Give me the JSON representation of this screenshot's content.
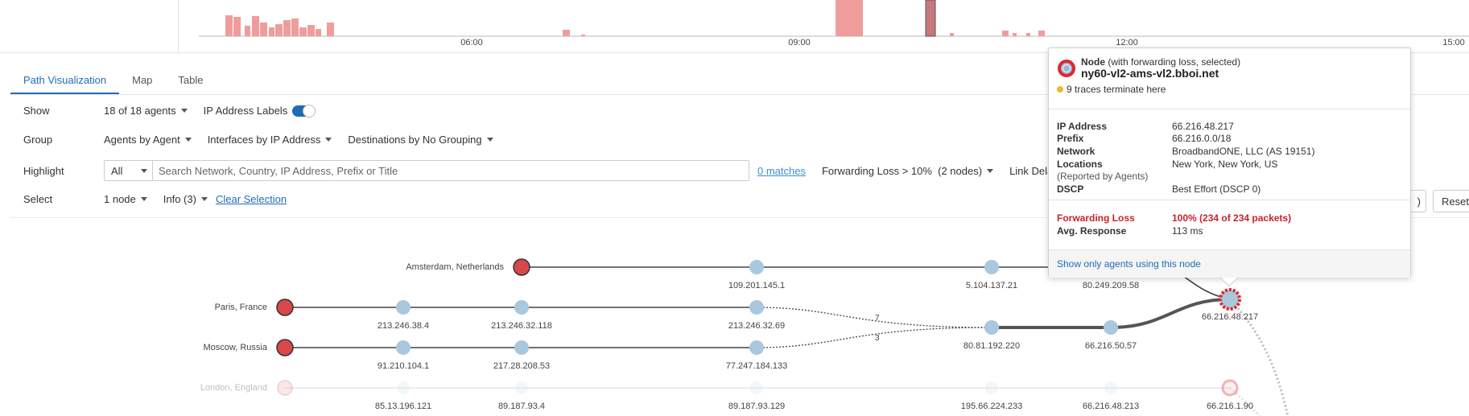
{
  "timeline": {
    "ticks": [
      "06:00",
      "09:00",
      "12:00",
      "15:00"
    ]
  },
  "tabs": [
    {
      "label": "Path Visualization",
      "active": true
    },
    {
      "label": "Map",
      "active": false
    },
    {
      "label": "Table",
      "active": false
    }
  ],
  "controls": {
    "show": {
      "label": "Show",
      "agents": "18 of 18 agents",
      "ip_labels": "IP Address Labels",
      "ip_labels_on": true
    },
    "group": {
      "label": "Group",
      "agents": "Agents by Agent",
      "interfaces": "Interfaces by IP Address",
      "destinations": "Destinations by No Grouping"
    },
    "highlight": {
      "label": "Highlight",
      "scope": "All",
      "placeholder": "Search Network, Country, IP Address, Prefix or Title",
      "matches": "0 matches",
      "forwarding_loss": "Forwarding Loss > 10%  (2 nodes)",
      "link_delay": "Link Delay >"
    },
    "select": {
      "label": "Select",
      "nodes": "1 node",
      "info": "Info (3)",
      "clear": "Clear Selection"
    },
    "buttons": {
      "partial": ")",
      "reset": "Reset"
    }
  },
  "graph": {
    "agents": [
      {
        "name": "Amsterdam, Netherlands"
      },
      {
        "name": "Paris, France"
      },
      {
        "name": "Moscow, Russia"
      },
      {
        "name": "London, England"
      }
    ],
    "ips": {
      "amsterdam": [
        "109.201.145.1",
        "5.104.137.21",
        "80.249.209.58"
      ],
      "paris": [
        "213.246.38.4",
        "213.246.32.118",
        "213.246.32.69"
      ],
      "moscow": [
        "91.210.104.1",
        "217.28.208.53",
        "77.247.184.133"
      ],
      "shared": [
        "80.81.192.220",
        "66.216.50.57",
        "66.216.48.217"
      ],
      "london": [
        "85.13.196.121",
        "89.187.93.4",
        "89.187.93.129",
        "195.66.224.233",
        "66.216.48.213",
        "66.216.1.90"
      ]
    },
    "link_counts": {
      "paris": "7",
      "moscow": "3"
    }
  },
  "popup": {
    "kind_bold": "Node",
    "kind_rest": " (with forwarding loss, selected)",
    "name": "ny60-vl2-ams-vl2.bboi.net",
    "traces": "9 traces terminate here",
    "fields": {
      "ip_label": "IP Address",
      "ip": "66.216.48.217",
      "prefix_label": "Prefix",
      "prefix": "66.216.0.0/18",
      "network_label": "Network",
      "network": "BroadbandONE, LLC (AS 19151)",
      "locations_label": "Locations",
      "locations": "New York, New York, US",
      "reported": "(Reported by Agents)",
      "dscp_label": "DSCP",
      "dscp": "Best Effort (DSCP 0)",
      "loss_label": "Forwarding Loss",
      "loss": "100% (234 of 234 packets)",
      "resp_label": "Avg. Response",
      "resp": "113 ms"
    },
    "footer_link": "Show only agents using this node"
  },
  "colors": {
    "accent": "#1f6db4",
    "loss_red": "#d9474b",
    "node_blue": "#a9c8de",
    "bar": "#ee9a99"
  }
}
